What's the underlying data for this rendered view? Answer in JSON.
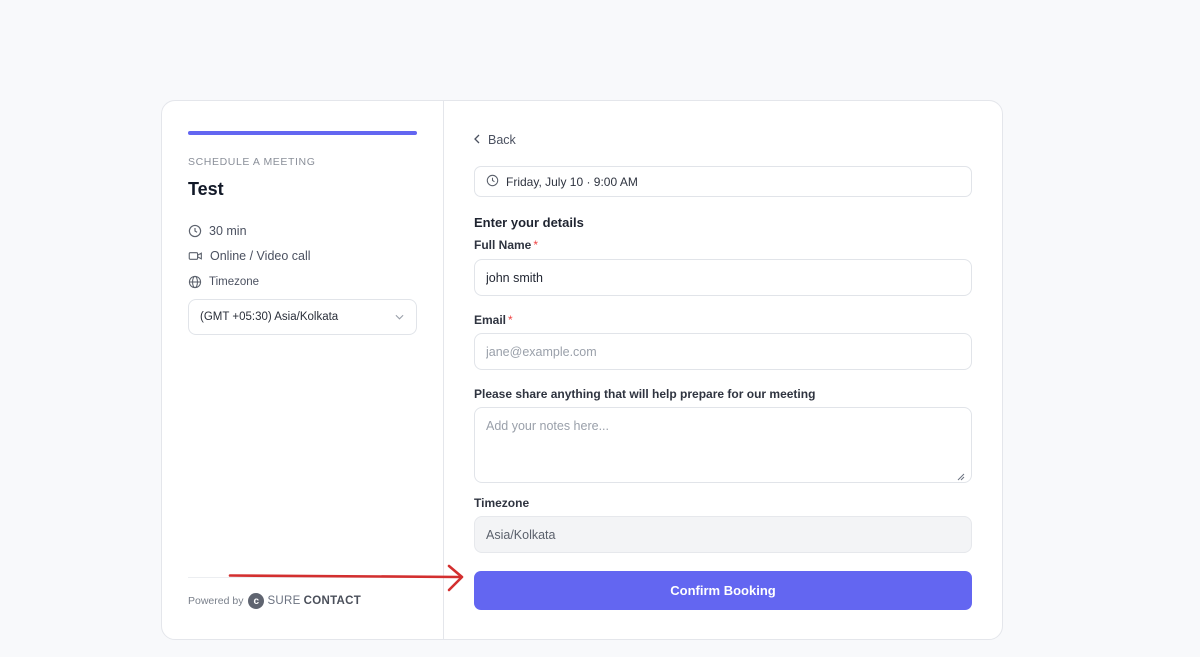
{
  "sidebar": {
    "eyebrow": "SCHEDULE A MEETING",
    "title": "Test",
    "duration": "30 min",
    "location": "Online / Video call",
    "timezone_label": "Timezone",
    "timezone_value": "(GMT +05:30) Asia/Kolkata",
    "powered_by": "Powered by",
    "brand_sure": "SURE",
    "brand_contact": "CONTACT"
  },
  "form": {
    "back_label": "Back",
    "selected_slot": "Friday, July 10 · 9:00 AM",
    "section_title": "Enter your details",
    "full_name_label": "Full Name",
    "full_name_value": "john smith",
    "email_label": "Email",
    "email_placeholder": "jane@example.com",
    "notes_label": "Please share anything that will help prepare for our meeting",
    "notes_placeholder": "Add your notes here...",
    "timezone_label": "Timezone",
    "timezone_value": "Asia/Kolkata",
    "required_marker": "*",
    "confirm_label": "Confirm Booking"
  },
  "icons": {
    "duration": "clock-icon",
    "location": "video-icon",
    "timezone": "globe-icon",
    "dropdown": "chevron-down-icon",
    "back": "chevron-left-icon",
    "slot": "clock-icon",
    "annotation": "arrow-icon"
  },
  "colors": {
    "accent": "#6366f1",
    "required": "#ef4444",
    "annotation_arrow": "#d32f2f"
  }
}
